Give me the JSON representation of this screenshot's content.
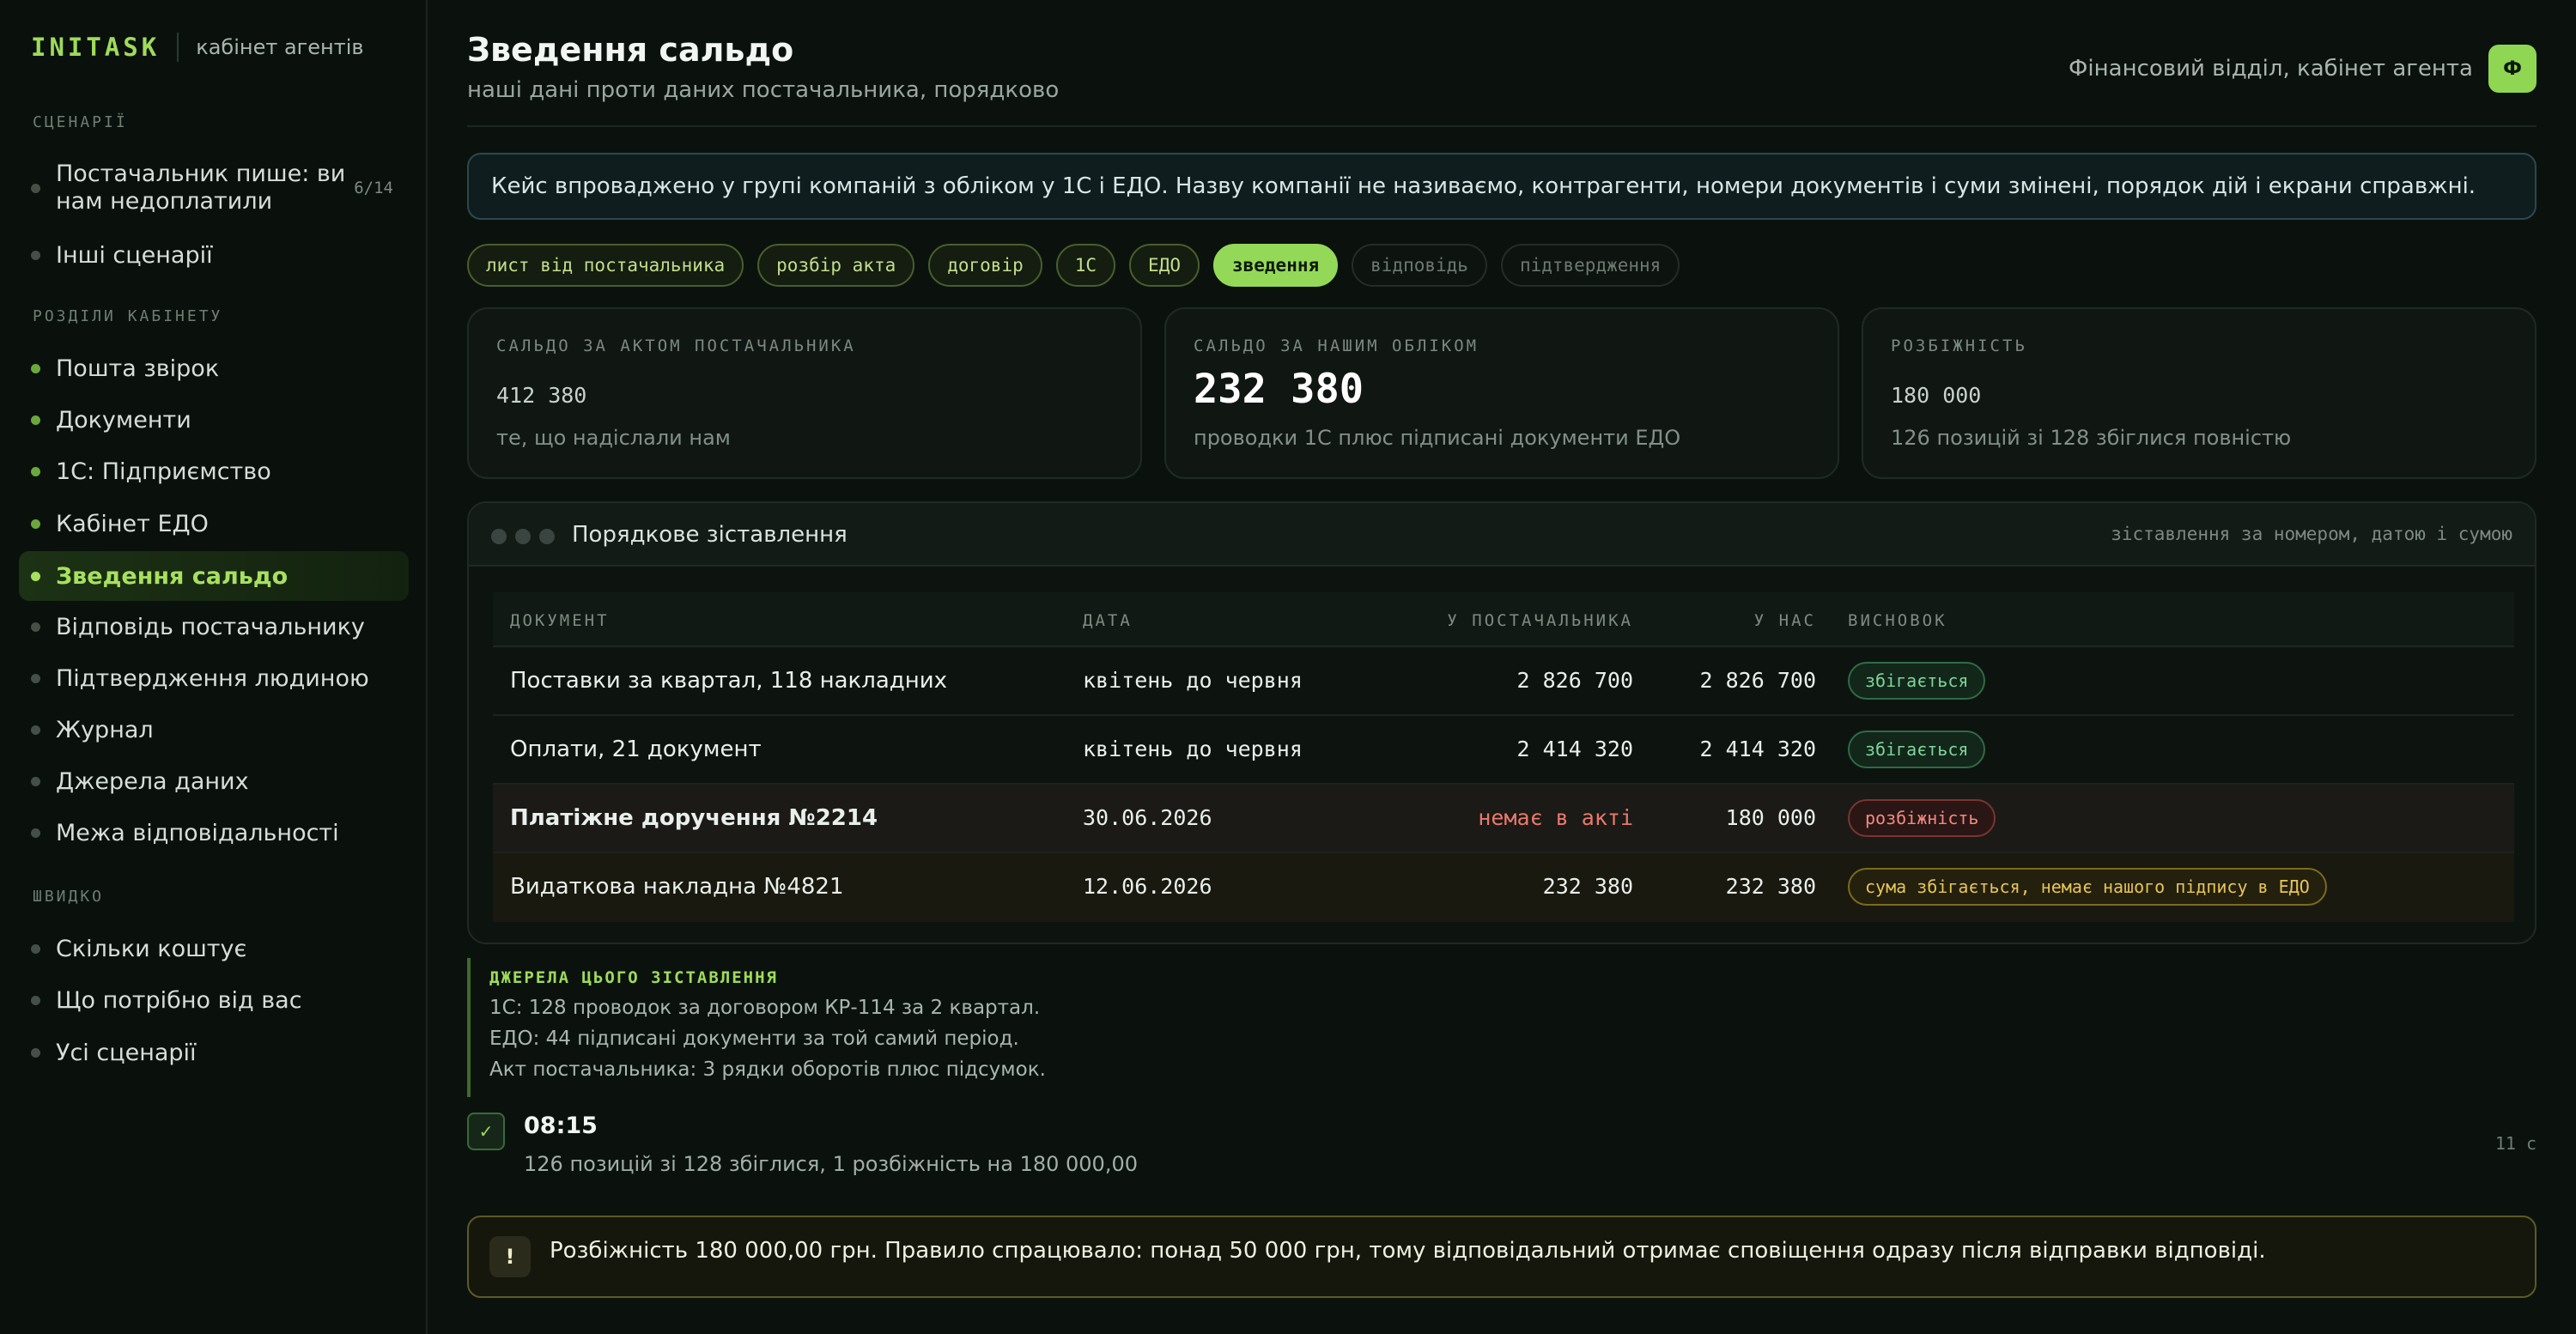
{
  "brand": {
    "logo": "INITASK",
    "subtitle": "кабінет агентів"
  },
  "sidebar": {
    "sections": [
      {
        "title": "СЦЕНАРІЇ"
      },
      {
        "title": "РОЗДІЛИ КАБІНЕТУ"
      },
      {
        "title": "ШВИДКО"
      }
    ],
    "scenario_items": [
      {
        "label_line1": "Постачальник пише: ви",
        "label_line2": "нам недоплатили",
        "count": "6/14"
      },
      {
        "label": "Інші сценарії"
      }
    ],
    "cabinet_items": [
      {
        "label": "Пошта звірок"
      },
      {
        "label": "Документи"
      },
      {
        "label": "1С: Підприємство"
      },
      {
        "label": "Кабінет ЕДО"
      },
      {
        "label": "Зведення сальдо"
      },
      {
        "label": "Відповідь постачальнику"
      },
      {
        "label": "Підтвердження людиною"
      },
      {
        "label": "Журнал"
      },
      {
        "label": "Джерела даних"
      },
      {
        "label": "Межа відповідальності"
      }
    ],
    "quick_items": [
      {
        "label": "Скільки коштує"
      },
      {
        "label": "Що потрібно від вас"
      },
      {
        "label": "Усі сценарії"
      }
    ]
  },
  "header": {
    "title": "Зведення сальдо",
    "subtitle": "наші дані проти даних постачальника, порядково",
    "user": "Фінансовий відділ, кабінет агента",
    "avatar": "Ф"
  },
  "notice": "Кейс впроваджено у групі компаній з обліком у 1С і ЕДО. Назву компанії не називаємо, контрагенти, номери документів і суми змінені, порядок дій і екрани справжні.",
  "steps": [
    "лист від постачальника",
    "розбір акта",
    "договір",
    "1С",
    "ЕДО",
    "зведення",
    "відповідь",
    "підтвердження"
  ],
  "cards": [
    {
      "label": "САЛЬДО ЗА АКТОМ ПОСТАЧАЛЬНИКА",
      "value": "412 380",
      "note": "те, що надіслали нам"
    },
    {
      "label": "САЛЬДО ЗА НАШИМ ОБЛІКОМ",
      "value": "232 380",
      "note": "проводки 1С плюс підписані документи ЕДО"
    },
    {
      "label": "РОЗБІЖНІСТЬ",
      "value": "180 000",
      "note": "126 позицій зі 128 збіглися повністю"
    }
  ],
  "table": {
    "title": "Порядкове зіставлення",
    "subtitle": "зіставлення за номером, датою і сумою",
    "columns": [
      "ДОКУМЕНТ",
      "ДАТА",
      "У ПОСТАЧАЛЬНИКА",
      "У НАС",
      "ВИСНОВОК"
    ],
    "rows": [
      {
        "doc": "Поставки за квартал, 118 накладних",
        "date": "квітень до червня",
        "supplier": "2 826 700",
        "ours": "2 826 700",
        "verdict": "збігається"
      },
      {
        "doc": "Оплати, 21 документ",
        "date": "квітень до червня",
        "supplier": "2 414 320",
        "ours": "2 414 320",
        "verdict": "збігається"
      },
      {
        "doc": "Платіжне доручення №2214",
        "date": "30.06.2026",
        "supplier": "немає в акті",
        "ours": "180 000",
        "verdict": "розбіжність"
      },
      {
        "doc": "Видаткова накладна №4821",
        "date": "12.06.2026",
        "supplier": "232 380",
        "ours": "232 380",
        "verdict": "сума збігається, немає нашого підпису в ЕДО"
      }
    ]
  },
  "sources": {
    "title": "ДЖЕРЕЛА ЦЬОГО ЗІСТАВЛЕННЯ",
    "lines": [
      "1С: 128 проводок за договором КР-114 за 2 квартал.",
      "ЕДО: 44 підписані документи за той самий період.",
      "Акт постачальника: 3 рядки оборотів плюс підсумок."
    ]
  },
  "log": {
    "icon": "✓",
    "time": "08:15",
    "text": "126 позицій зі 128 збіглися, 1 розбіжність на 180 000,00",
    "duration": "11 с"
  },
  "alert": {
    "icon": "!",
    "text": "Розбіжність 180 000,00 грн. Правило спрацювало: понад 50 000 грн, тому відповідальний отримає сповіщення одразу після відправки відповіді."
  },
  "colors": {
    "accent": "#93d957",
    "background": "#0b120e",
    "ok": "#7fd49a",
    "error": "#f08a80",
    "warning": "#e7c45a"
  }
}
